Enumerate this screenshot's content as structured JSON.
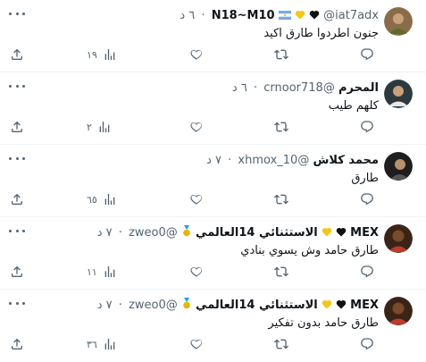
{
  "tweets": [
    {
      "name": "N18~M10",
      "name_suffix": "",
      "handle": "@iat7adx",
      "time": "٦ د",
      "text": "جنون اطردوا طارق اكيد",
      "views": "١٩",
      "avatar_color": "#7a5a3a"
    },
    {
      "name": "المحرم",
      "name_suffix": "",
      "handle": "@crnoor718",
      "time": "٦ د",
      "text": "كلهم طيب",
      "views": "٢",
      "avatar_color": "#1c2b33"
    },
    {
      "name": "محمد كلاش",
      "name_suffix": "",
      "handle": "@xhmox_10",
      "time": "٧ د",
      "text": "طارق",
      "views": "٦٥",
      "avatar_color": "#3b3b3b"
    },
    {
      "name": "الاستثنائي 14العالمي",
      "name_suffix": "MEX",
      "handle": "@zweo0",
      "time": "٧ د",
      "text": "طارق حامد وش يسوي بنادي",
      "views": "١١",
      "avatar_color": "#4a2a1a"
    },
    {
      "name": "الاستثنائي 14العالمي",
      "name_suffix": "MEX",
      "handle": "@zweo0",
      "time": "٧ د",
      "text": "طارق حامد بدون تفكير",
      "views": "٣٦",
      "avatar_color": "#4a2a1a"
    }
  ],
  "icons": {
    "reply": "reply-icon",
    "retweet": "retweet-icon",
    "like": "like-icon",
    "views": "views-icon",
    "share": "share-icon",
    "more": "more-icon"
  }
}
